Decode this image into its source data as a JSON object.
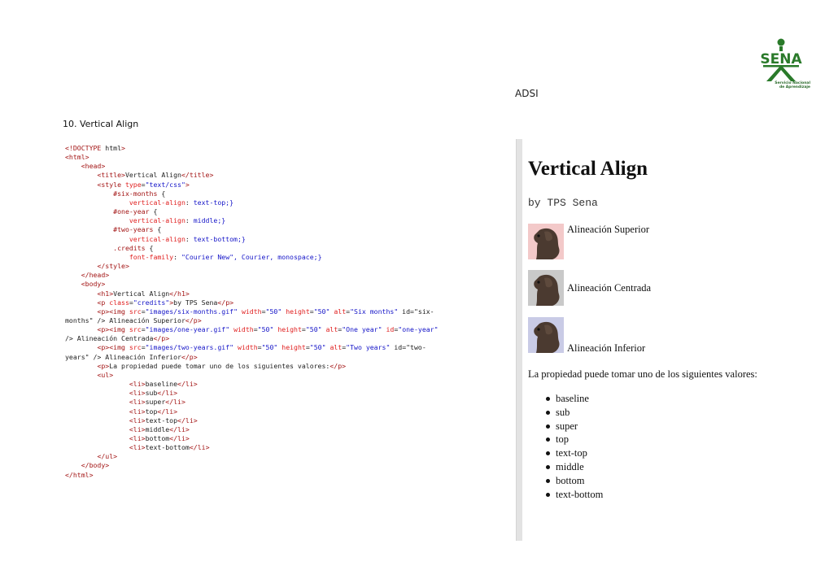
{
  "header": {
    "program": "ADSI",
    "logo_text": "SENA",
    "logo_caption_line1": "Servicio Nacional",
    "logo_caption_line2": "de Aprendizaje"
  },
  "section": {
    "title": "10. Vertical Align"
  },
  "code_lines": [
    "<!DOCTYPE html>",
    "<html>",
    "    <head>",
    "        <title>Vertical Align</title>",
    "        <style type=\"text/css\">",
    "            #six-months {",
    "                vertical-align: text-top;}",
    "            #one-year {",
    "                vertical-align: middle;}",
    "            #two-years {",
    "                vertical-align: text-bottom;}",
    "            .credits {",
    "                font-family: \"Courier New\", Courier, monospace;}",
    "        </style>",
    "    </head>",
    "    <body>",
    "        <h1>Vertical Align</h1>",
    "        <p class=\"credits\">by TPS Sena</p>",
    "        <p><img src=\"images/six-months.gif\" width=\"50\" height=\"50\" alt=\"Six months\" id=\"six-",
    "months\" /> Alineación Superior</p>",
    "        <p><img src=\"images/one-year.gif\" width=\"50\" height=\"50\" alt=\"One year\" id=\"one-year\"",
    "/> Alineación Centrada</p>",
    "        <p><img src=\"images/two-years.gif\" width=\"50\" height=\"50\" alt=\"Two years\" id=\"two-",
    "years\" /> Alineación Inferior</p>",
    "        <p>La propiedad puede tomar uno de los siguientes valores:</p>",
    "        <ul>",
    "                <li>baseline</li>",
    "                <li>sub</li>",
    "                <li>super</li>",
    "                <li>top</li>",
    "                <li>text-top</li>",
    "                <li>middle</li>",
    "                <li>bottom</li>",
    "                <li>text-bottom</li>",
    "        </ul>",
    "    </body>",
    "</html>"
  ],
  "preview": {
    "title": "Vertical Align",
    "credits": "by TPS Sena",
    "rows": [
      {
        "label": "Alineación Superior",
        "img_bg": "#f3c9c9",
        "align": "text-top"
      },
      {
        "label": "Alineación Centrada",
        "img_bg": "#c9c9c9",
        "align": "middle"
      },
      {
        "label": "Alineación Inferior",
        "img_bg": "#c9cbe6",
        "align": "text-bottom"
      }
    ],
    "paragraph": "La propiedad puede tomar uno de los siguientes valores:",
    "values": [
      "baseline",
      "sub",
      "super",
      "top",
      "text-top",
      "middle",
      "bottom",
      "text-bottom"
    ]
  },
  "colors": {
    "tag": "#a31515",
    "attr": "#e01e1e",
    "value": "#1515c8",
    "logo_green": "#2a7a2a"
  }
}
